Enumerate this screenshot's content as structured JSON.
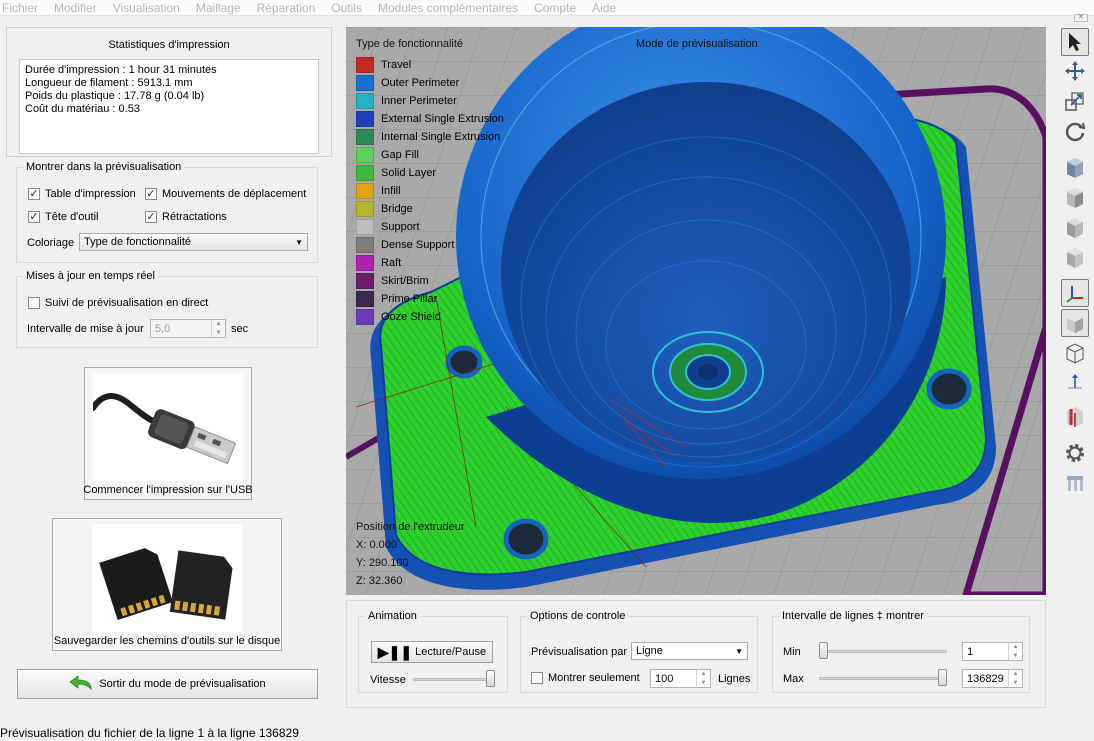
{
  "menu": [
    "Fichier",
    "Modifier",
    "Visualisation",
    "Maillage",
    "Réparation",
    "Outils",
    "Modules complémentaires",
    "Compte",
    "Aide"
  ],
  "stats": {
    "title": "Statistiques d'impression",
    "lines": [
      "Durée d'impression : 1 hour 31 minutes",
      "Longueur de filament : 5913.1 mm",
      "Poids du plastique : 17.78 g (0.04 lb)",
      "Coût du matériau : 0.53"
    ]
  },
  "show": {
    "title": "Montrer dans la prévisualisation",
    "options": [
      {
        "label": "Table d'impression",
        "checked": true
      },
      {
        "label": "Mouvements de déplacement",
        "checked": true
      },
      {
        "label": "Tête d'outil",
        "checked": true
      },
      {
        "label": "Rétractations",
        "checked": true
      }
    ],
    "coloring_label": "Coloriage",
    "coloring_value": "Type de fonctionnalité"
  },
  "live": {
    "title": "Mises à jour en temps réel",
    "follow_label": "Suivi de prévisualisation en direct",
    "follow_checked": false,
    "interval_label": "Intervalle de mise à jour",
    "interval_value": "5,0",
    "interval_unit": "sec"
  },
  "buttons": {
    "usb": "Commencer l'impression sur l'USB",
    "sd": "Sauvegarder les chemins d'outils sur le disque",
    "exit": "Sortir du mode de prévisualisation"
  },
  "viewport": {
    "legend_title": "Type de fonctionnalité",
    "mode_title": "Mode de prévisualisation",
    "legend": [
      {
        "label": "Travel",
        "color": "#c62828"
      },
      {
        "label": "Outer Perimeter",
        "color": "#1a6fd1"
      },
      {
        "label": "Inner Perimeter",
        "color": "#24b3c4"
      },
      {
        "label": "External Single Extrusion",
        "color": "#2140b8"
      },
      {
        "label": "Internal Single Extrusion",
        "color": "#2e8b57"
      },
      {
        "label": "Gap Fill",
        "color": "#5ccf5c"
      },
      {
        "label": "Solid Layer",
        "color": "#3db83d"
      },
      {
        "label": "Infill",
        "color": "#e0a11b"
      },
      {
        "label": "Bridge",
        "color": "#b5b52b"
      },
      {
        "label": "Support",
        "color": "#bdbdbd"
      },
      {
        "label": "Dense Support",
        "color": "#7d7d7d"
      },
      {
        "label": "Raft",
        "color": "#b022b0"
      },
      {
        "label": "Skirt/Brim",
        "color": "#6b1f6b"
      },
      {
        "label": "Prime Pillar",
        "color": "#3c2a4d"
      },
      {
        "label": "Ooze Shield",
        "color": "#6a3bb5"
      }
    ],
    "extruder_title": "Position de l'extrudeur",
    "x": "X: 0.000",
    "y": "Y: 290.100",
    "z": "Z: 32.360"
  },
  "animation": {
    "title": "Animation",
    "play_label": "Lecture/Pause",
    "speed_label": "Vitesse",
    "speed_value": 1.0
  },
  "control": {
    "title": "Options de controle",
    "preview_by_label": "Prévisualisation par",
    "preview_by_value": "Ligne",
    "only_label": "Montrer seulement",
    "only_checked": false,
    "only_value": "100",
    "only_unit": "Lignes"
  },
  "range": {
    "title": "Intervalle de lignes ‡ montrer",
    "min_label": "Min",
    "min_value": "1",
    "max_label": "Max",
    "max_value": "136829"
  },
  "toolbar_icons": [
    "select-arrow-icon",
    "move-icon",
    "scale-icon",
    "rotate-icon",
    "view-front-icon",
    "view-back-icon",
    "view-left-icon",
    "view-right-icon",
    "axis-icon",
    "solid-view-icon",
    "wireframe-view-icon",
    "axis-arrow-icon",
    "cut-icon",
    "settings-gear-icon",
    "supports-icon"
  ],
  "status": "Prévisualisation du fichier de la ligne 1 à la ligne 136829"
}
